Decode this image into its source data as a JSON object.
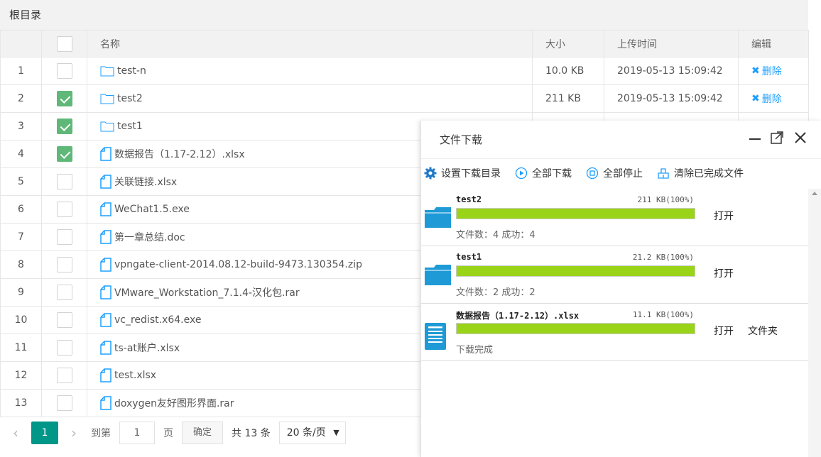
{
  "root_title": "根目录",
  "columns": {
    "name": "名称",
    "size": "大小",
    "time": "上传时间",
    "edit": "编辑"
  },
  "rows": [
    {
      "no": "1",
      "checked": false,
      "type": "folder",
      "name": "test-n",
      "size": "10.0 KB",
      "time": "2019-05-13 15:09:42",
      "action": "删除"
    },
    {
      "no": "2",
      "checked": true,
      "type": "folder",
      "name": "test2",
      "size": "211 KB",
      "time": "2019-05-13 15:09:42",
      "action": "删除"
    },
    {
      "no": "3",
      "checked": true,
      "type": "folder",
      "name": "test1"
    },
    {
      "no": "4",
      "checked": true,
      "type": "file",
      "name": "数据报告（1.17-2.12）.xlsx"
    },
    {
      "no": "5",
      "checked": false,
      "type": "file",
      "name": "关联链接.xlsx"
    },
    {
      "no": "6",
      "checked": false,
      "type": "file",
      "name": "WeChat1.5.exe"
    },
    {
      "no": "7",
      "checked": false,
      "type": "file",
      "name": "第一章总结.doc"
    },
    {
      "no": "8",
      "checked": false,
      "type": "file",
      "name": "vpngate-client-2014.08.12-build-9473.130354.zip"
    },
    {
      "no": "9",
      "checked": false,
      "type": "file",
      "name": "VMware_Workstation_7.1.4-汉化包.rar"
    },
    {
      "no": "10",
      "checked": false,
      "type": "file",
      "name": "vc_redist.x64.exe"
    },
    {
      "no": "11",
      "checked": false,
      "type": "file",
      "name": "ts-at账户.xlsx"
    },
    {
      "no": "12",
      "checked": false,
      "type": "file",
      "name": "test.xlsx"
    },
    {
      "no": "13",
      "checked": false,
      "type": "file",
      "name": "doxygen友好图形界面.rar"
    }
  ],
  "pager": {
    "prev": "‹",
    "current": "1",
    "next": "›",
    "goto": "到第",
    "page_input": "1",
    "page_unit": "页",
    "confirm": "确定",
    "total": "共 13 条",
    "limit": "20 条/页"
  },
  "download": {
    "title": "文件下载",
    "toolbar": {
      "set_dir": "设置下载目录",
      "download_all": "全部下载",
      "stop_all": "全部停止",
      "clear_done": "清除已完成文件"
    },
    "items": [
      {
        "icon": "folder-icon",
        "name": "test2",
        "size": "211 KB(100%)",
        "progress": 1.0,
        "sub": "文件数：4 成功：4",
        "open": "打开",
        "folder": ""
      },
      {
        "icon": "folder-icon",
        "name": "test1",
        "size": "21.2 KB(100%)",
        "progress": 1.0,
        "sub": "文件数：2 成功：2",
        "open": "打开",
        "folder": ""
      },
      {
        "icon": "document-icon",
        "name": "数据报告（1.17-2.12）.xlsx",
        "size": "11.1 KB(100%)",
        "progress": 1.0,
        "sub": "下载完成",
        "open": "打开",
        "folder": "文件夹"
      }
    ]
  },
  "colors": {
    "accent": "#1e9fff",
    "checkbox_checked": "#5fb878",
    "progress": "#99d418",
    "pager_active": "#009688"
  }
}
